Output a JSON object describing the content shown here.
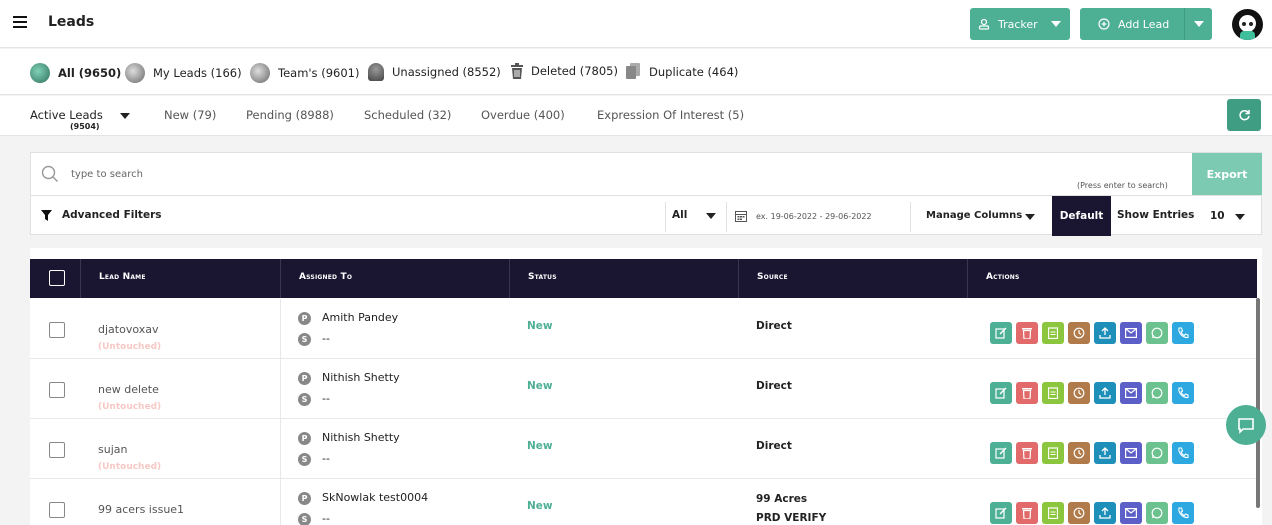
{
  "header": {
    "title": "Leads",
    "tracker_label": "Tracker",
    "add_lead_label": "Add Lead"
  },
  "categories": [
    {
      "label": "All (9650)",
      "icon": "globe-icon",
      "bold": true
    },
    {
      "label": "My Leads (166)",
      "icon": "user-globe-icon"
    },
    {
      "label": "Team's (9601)",
      "icon": "team-globe-icon"
    },
    {
      "label": "Unassigned (8552)",
      "icon": "unassigned-user-icon"
    },
    {
      "label": "Deleted (7805)",
      "icon": "trash-icon"
    },
    {
      "label": "Duplicate (464)",
      "icon": "duplicate-icon"
    }
  ],
  "tabs": {
    "active_label": "Active Leads",
    "active_count": "(9504)",
    "items": [
      "New (79)",
      "Pending (8988)",
      "Scheduled (32)",
      "Overdue (400)",
      "Expression Of Interest (5)"
    ]
  },
  "search": {
    "placeholder": "type to search",
    "hint": "(Press enter to search)",
    "export_label": "Export"
  },
  "filters": {
    "advanced_label": "Advanced Filters",
    "all_value": "All",
    "date_placeholder": "ex. 19-06-2022 - 29-06-2022",
    "manage_columns_label": "Manage Columns",
    "default_label": "Default",
    "show_entries_label": "Show Entries",
    "entries_value": "10"
  },
  "table": {
    "headers": [
      "Lead Name",
      "Assigned To",
      "Status",
      "Source",
      "Actions"
    ],
    "rows": [
      {
        "name": "djatovoxav",
        "sub": "(Untouched)",
        "p": "Amith Pandey",
        "s": "--",
        "status": "New",
        "source": "Direct",
        "source2": ""
      },
      {
        "name": "new delete",
        "sub": "(Untouched)",
        "p": "Nithish Shetty",
        "s": "--",
        "status": "New",
        "source": "Direct",
        "source2": ""
      },
      {
        "name": "sujan",
        "sub": "(Untouched)",
        "p": "Nithish Shetty",
        "s": "--",
        "status": "New",
        "source": "Direct",
        "source2": ""
      },
      {
        "name": "99 acers issue1",
        "sub": "",
        "p": "SkNowlak test0004",
        "s": "--",
        "status": "New",
        "source": "99 Acres",
        "source2": "PRD VERIFY"
      }
    ],
    "pill_p": "P",
    "pill_s": "S"
  },
  "colors": {
    "accent": "#4daf94",
    "header_dark": "#1a1530",
    "edit": "#4daf94",
    "delete": "#e26a6a",
    "notes": "#8cc63f",
    "history": "#b07a4a",
    "upload": "#1e8fb8",
    "mail": "#5b5fc7",
    "whatsapp": "#6cc28e",
    "call": "#2ea8e0"
  }
}
